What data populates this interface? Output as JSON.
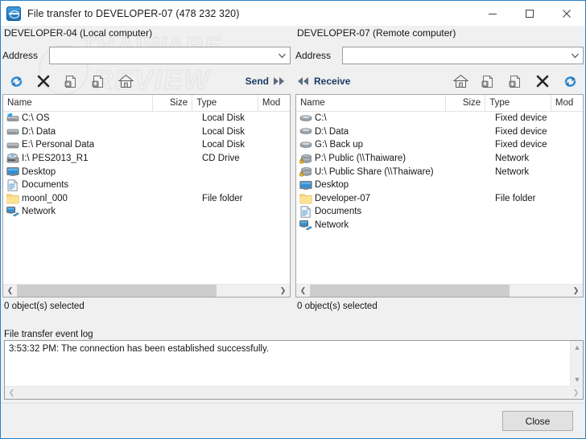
{
  "window": {
    "title": "File transfer to DEVELOPER-07 (478 232 320)",
    "title_icon": "transfer-arrows-icon",
    "minimize_label": "–",
    "maximize_label": "□",
    "close_label": "✕",
    "watermark": "THAIWARE REVIEW",
    "accent_color": "#2a7fc9"
  },
  "left_panel": {
    "computer_label": "DEVELOPER-04 (Local computer)",
    "address": {
      "label": "Address",
      "value": "",
      "placeholder": ""
    },
    "toolbar": {
      "refresh_label": "Refresh",
      "delete_label": "Delete",
      "download_label": "Download",
      "upload_label": "Upload",
      "home_label": "Home",
      "transfer_label": "Send"
    },
    "columns": [
      "Name",
      "Size",
      "Type",
      "Mod"
    ],
    "rows": [
      {
        "icon": "local-disk-system-icon",
        "name": "C:\\  OS",
        "size": "",
        "type": "Local Disk"
      },
      {
        "icon": "local-disk-icon",
        "name": "D:\\  Data",
        "size": "",
        "type": "Local Disk"
      },
      {
        "icon": "local-disk-icon",
        "name": "E:\\  Personal Data",
        "size": "",
        "type": "Local Disk"
      },
      {
        "icon": "cd-drive-icon",
        "name": "I:\\  PES2013_R1",
        "size": "",
        "type": "CD Drive"
      },
      {
        "icon": "desktop-icon",
        "name": "Desktop",
        "size": "",
        "type": ""
      },
      {
        "icon": "documents-icon",
        "name": "Documents",
        "size": "",
        "type": ""
      },
      {
        "icon": "folder-icon",
        "name": "moonl_000",
        "size": "",
        "type": "File folder"
      },
      {
        "icon": "network-icon",
        "name": "Network",
        "size": "",
        "type": ""
      }
    ],
    "status": "0 object(s) selected"
  },
  "right_panel": {
    "computer_label": "DEVELOPER-07 (Remote computer)",
    "address": {
      "label": "Address",
      "value": "",
      "placeholder": ""
    },
    "toolbar": {
      "refresh_label": "Refresh",
      "delete_label": "Delete",
      "download_label": "Download",
      "upload_label": "Upload",
      "home_label": "Home",
      "transfer_label": "Receive"
    },
    "columns": [
      "Name",
      "Size",
      "Type",
      "Mod"
    ],
    "rows": [
      {
        "icon": "fixed-device-icon",
        "name": "C:\\",
        "size": "",
        "type": "Fixed device"
      },
      {
        "icon": "fixed-device-icon",
        "name": "D:\\  Data",
        "size": "",
        "type": "Fixed device"
      },
      {
        "icon": "fixed-device-icon",
        "name": "G:\\  Back up",
        "size": "",
        "type": "Fixed device"
      },
      {
        "icon": "network-drive-icon",
        "name": "P:\\  Public (\\\\Thaiware)",
        "size": "",
        "type": "Network"
      },
      {
        "icon": "network-drive-icon",
        "name": "U:\\  Public Share (\\\\Thaiware)",
        "size": "",
        "type": "Network"
      },
      {
        "icon": "desktop-icon",
        "name": "Desktop",
        "size": "",
        "type": ""
      },
      {
        "icon": "folder-icon",
        "name": "Developer-07",
        "size": "",
        "type": "File folder"
      },
      {
        "icon": "documents-icon",
        "name": "Documents",
        "size": "",
        "type": ""
      },
      {
        "icon": "network-icon",
        "name": "Network",
        "size": "",
        "type": ""
      }
    ],
    "status": "0 object(s) selected"
  },
  "event_log": {
    "label": "File transfer event log",
    "entries": [
      "3:53:32 PM: The connection has been established successfully."
    ]
  },
  "footer": {
    "close_label": "Close"
  }
}
